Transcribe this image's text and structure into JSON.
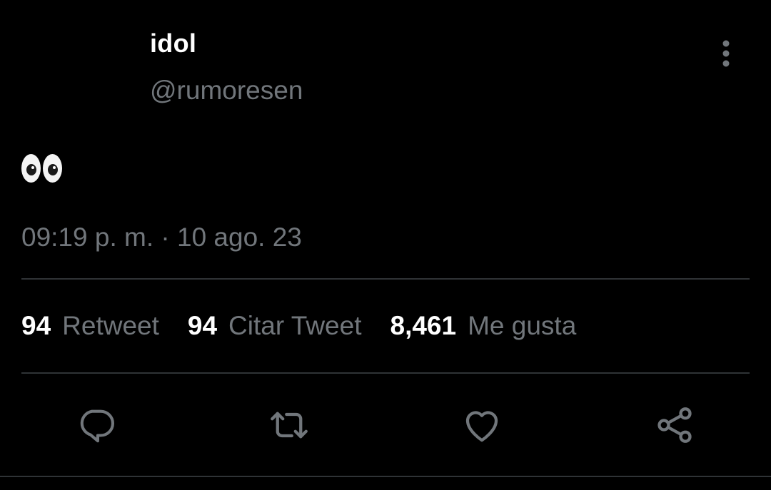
{
  "author": {
    "display_name": "idol",
    "handle": "@rumoresen"
  },
  "tweet": {
    "text_emoji": "eyes",
    "timestamp": "09:19 p. m. · 10 ago. 23"
  },
  "stats": [
    {
      "count": "94",
      "label": "Retweet"
    },
    {
      "count": "94",
      "label": "Citar Tweet"
    },
    {
      "count": "8,461",
      "label": "Me gusta"
    }
  ],
  "actions": [
    {
      "icon": "reply-icon"
    },
    {
      "icon": "retweet-icon"
    },
    {
      "icon": "like-icon"
    },
    {
      "icon": "share-icon"
    }
  ],
  "colors": {
    "background": "#000000",
    "primary_text": "#ffffff",
    "secondary_text": "#71767b",
    "divider": "#2f3336"
  }
}
